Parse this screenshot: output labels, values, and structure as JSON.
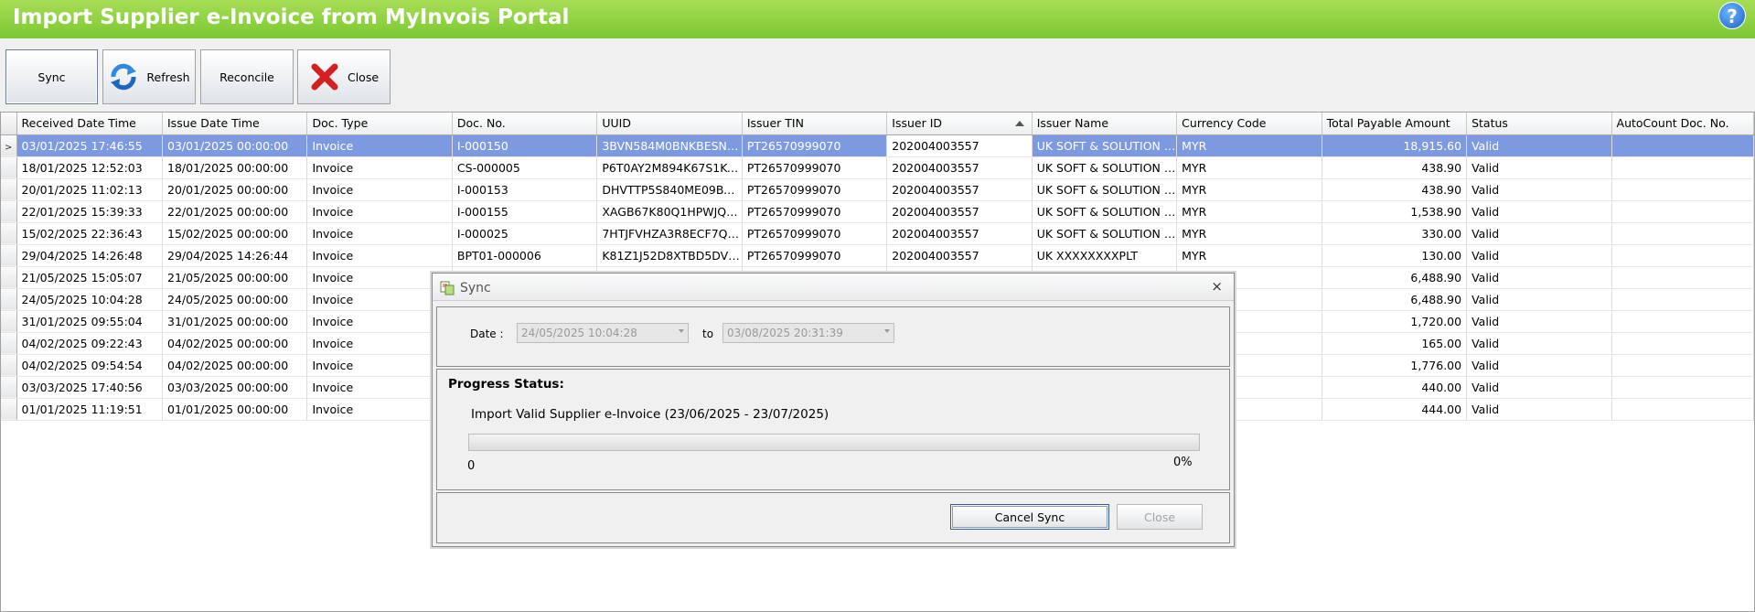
{
  "window": {
    "title": "Import Supplier e-Invoice from MyInvois Portal",
    "help": "?"
  },
  "toolbar": {
    "sync_label": "Sync",
    "refresh_label": "Refresh",
    "reconcile_label": "Reconcile",
    "close_label": "Close"
  },
  "grid": {
    "columns": [
      "Received Date Time",
      "Issue Date Time",
      "Doc. Type",
      "Doc. No.",
      "UUID",
      "Issuer TIN",
      "Issuer ID",
      "Issuer Name",
      "Currency Code",
      "Total Payable Amount",
      "Status",
      "AutoCount Doc. No."
    ],
    "sorted_column": "Issuer ID",
    "rows": [
      [
        "03/01/2025 17:46:55",
        "03/01/2025 00:00:00",
        "Invoice",
        "I-000150",
        "3BVN584M0BNKBESNCE...",
        "PT26570999070",
        "202004003557",
        "UK SOFT & SOLUTION P...",
        "MYR",
        "18,915.60",
        "Valid",
        ""
      ],
      [
        "18/01/2025 12:52:03",
        "18/01/2025 00:00:00",
        "Invoice",
        "CS-000005",
        "P6T0AY2M894K67S1KC...",
        "PT26570999070",
        "202004003557",
        "UK SOFT & SOLUTION P...",
        "MYR",
        "438.90",
        "Valid",
        ""
      ],
      [
        "20/01/2025 11:02:13",
        "20/01/2025 00:00:00",
        "Invoice",
        "I-000153",
        "DHVTTP5S840ME09BW...",
        "PT26570999070",
        "202004003557",
        "UK SOFT & SOLUTION P...",
        "MYR",
        "438.90",
        "Valid",
        ""
      ],
      [
        "22/01/2025 15:39:33",
        "22/01/2025 00:00:00",
        "Invoice",
        "I-000155",
        "XAGB67K80Q1HPWJQ6...",
        "PT26570999070",
        "202004003557",
        "UK SOFT & SOLUTION P...",
        "MYR",
        "1,538.90",
        "Valid",
        ""
      ],
      [
        "15/02/2025 22:36:43",
        "15/02/2025 00:00:00",
        "Invoice",
        "I-000025",
        "7HTJFVHZA3R8ECF7QB...",
        "PT26570999070",
        "202004003557",
        "UK SOFT & SOLUTION P...",
        "MYR",
        "330.00",
        "Valid",
        ""
      ],
      [
        "29/04/2025 14:26:48",
        "29/04/2025 14:26:44",
        "Invoice",
        "BPT01-000006",
        "K81Z1J52D8XTBD5DVG1...",
        "PT26570999070",
        "202004003557",
        "UK XXXXXXXXPLT",
        "MYR",
        "130.00",
        "Valid",
        ""
      ],
      [
        "21/05/2025 15:05:07",
        "21/05/2025 00:00:00",
        "Invoice",
        "",
        "",
        "",
        "",
        "",
        "",
        "6,488.90",
        "Valid",
        ""
      ],
      [
        "24/05/2025 10:04:28",
        "24/05/2025 00:00:00",
        "Invoice",
        "",
        "",
        "",
        "",
        "",
        "",
        "6,488.90",
        "Valid",
        ""
      ],
      [
        "31/01/2025 09:55:04",
        "31/01/2025 00:00:00",
        "Invoice",
        "",
        "",
        "",
        "",
        "",
        "",
        "1,720.00",
        "Valid",
        ""
      ],
      [
        "04/02/2025 09:22:43",
        "04/02/2025 00:00:00",
        "Invoice",
        "",
        "",
        "",
        "",
        "",
        "",
        "165.00",
        "Valid",
        ""
      ],
      [
        "04/02/2025 09:54:54",
        "04/02/2025 00:00:00",
        "Invoice",
        "",
        "",
        "",
        "",
        "",
        "",
        "1,776.00",
        "Valid",
        ""
      ],
      [
        "03/03/2025 17:40:56",
        "03/03/2025 00:00:00",
        "Invoice",
        "",
        "",
        "",
        "",
        "",
        "",
        "440.00",
        "Valid",
        ""
      ],
      [
        "01/01/2025 11:19:51",
        "01/01/2025 00:00:00",
        "Invoice",
        "",
        "",
        "",
        "",
        "",
        "",
        "444.00",
        "Valid",
        ""
      ]
    ]
  },
  "dialog": {
    "title": "Sync",
    "close_glyph": "×",
    "date_label": "Date :",
    "date_from": "24/05/2025 10:04:28",
    "to_label": "to",
    "date_to": "03/08/2025 20:31:39",
    "progress_title": "Progress Status:",
    "progress_text": "Import Valid Supplier e-Invoice (23/06/2025 - 23/07/2025)",
    "progress_min": "0",
    "progress_percent_text": "0%",
    "progress_fraction": 0,
    "cancel_label": "Cancel Sync",
    "close_label": "Close"
  }
}
